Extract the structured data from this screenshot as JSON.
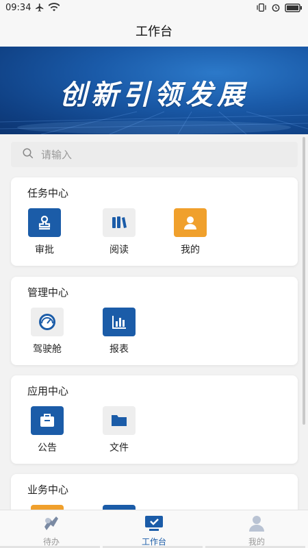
{
  "status_bar": {
    "time": "09:34",
    "left_icons": [
      "airplane-icon",
      "wifi-icon"
    ],
    "right_icons": [
      "vibrate-icon",
      "alarm-icon",
      "battery-icon"
    ]
  },
  "header": {
    "title": "工作台"
  },
  "banner": {
    "text": "创新引领发展"
  },
  "search": {
    "placeholder": "请输入"
  },
  "sections": [
    {
      "title": "任务中心",
      "items": [
        {
          "label": "审批",
          "icon": "stamp-icon",
          "color": "#1b5ca8"
        },
        {
          "label": "阅读",
          "icon": "book-icon",
          "color": "#eeeeee"
        },
        {
          "label": "我的",
          "icon": "user-icon",
          "color": "#f0a02c"
        }
      ]
    },
    {
      "title": "管理中心",
      "items": [
        {
          "label": "驾驶舱",
          "icon": "gauge-icon",
          "color": "#eeeeee"
        },
        {
          "label": "报表",
          "icon": "bar-chart-icon",
          "color": "#1b5ca8"
        }
      ]
    },
    {
      "title": "应用中心",
      "items": [
        {
          "label": "公告",
          "icon": "briefcase-icon",
          "color": "#1b5ca8"
        },
        {
          "label": "文件",
          "icon": "folder-icon",
          "color": "#eeeeee"
        }
      ]
    },
    {
      "title": "业务中心",
      "items": [
        {
          "icon": "tile-icon",
          "color": "#f0a02c"
        },
        {
          "icon": "tile-icon",
          "color": "#1b5ca8"
        }
      ]
    }
  ],
  "tabbar": {
    "tabs": [
      {
        "label": "待办",
        "icon": "todo-icon",
        "active": false
      },
      {
        "label": "工作台",
        "icon": "workbench-icon",
        "active": true
      },
      {
        "label": "我的",
        "icon": "profile-icon",
        "active": false
      }
    ],
    "accent": "#1b5ca8"
  }
}
